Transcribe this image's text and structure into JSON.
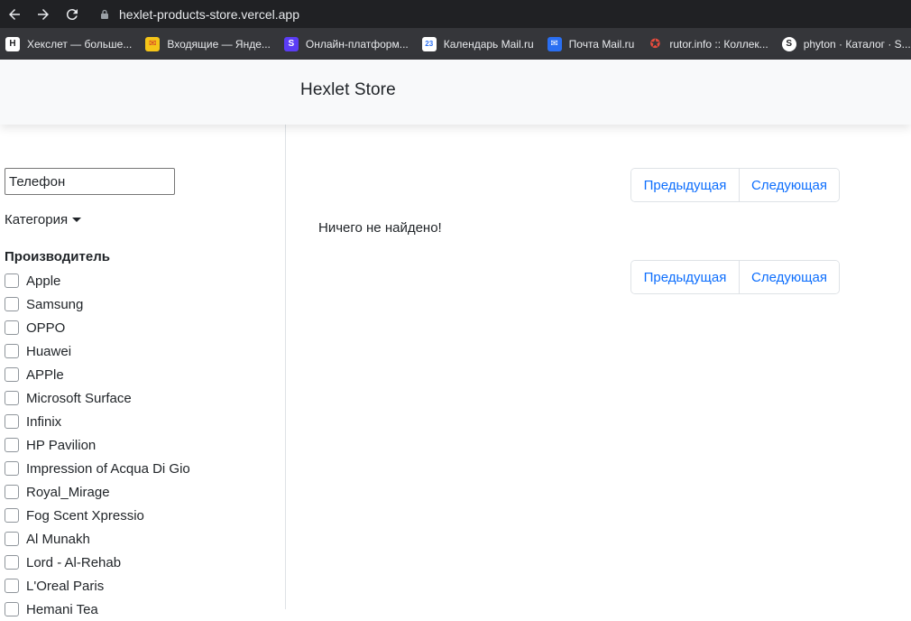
{
  "browser": {
    "url": "hexlet-products-store.vercel.app",
    "bookmarks": [
      {
        "label": "Хекслет — больше...",
        "icon": "hexlet-icon",
        "color": "#ffffff"
      },
      {
        "label": "Входящие — Янде...",
        "icon": "mail-envelope-icon",
        "color": "#f5c518"
      },
      {
        "label": "Онлайн-платформ...",
        "icon": "s-logo-icon",
        "color": "#5b3df5"
      },
      {
        "label": "Календарь Mail.ru",
        "icon": "calendar-icon",
        "color": "#2a6ff2"
      },
      {
        "label": "Почта Mail.ru",
        "icon": "mail-icon",
        "color": "#2a6ff2"
      },
      {
        "label": "rutor.info :: Коллек...",
        "icon": "rutor-icon",
        "color": "#e84c3d"
      },
      {
        "label": "phyton · Каталог · S...",
        "icon": "link-icon",
        "color": "#ffffff"
      }
    ]
  },
  "header": {
    "brand": "Hexlet Store"
  },
  "sidebar": {
    "search_value": "Телефон",
    "category_label": "Категория",
    "maker_title": "Производитель",
    "makers": [
      "Apple",
      "Samsung",
      "OPPO",
      "Huawei",
      "APPle",
      "Microsoft Surface",
      "Infinix",
      "HP Pavilion",
      "Impression of Acqua Di Gio",
      "Royal_Mirage",
      "Fog Scent Xpressio",
      "Al Munakh",
      "Lord - Al-Rehab",
      "L'Oreal Paris",
      "Hemani Tea"
    ]
  },
  "main": {
    "prev_label": "Предыдущая",
    "next_label": "Следующая",
    "empty_message": "Ничего не найдено!"
  },
  "colors": {
    "link": "#0d6efd",
    "browser_bg": "#202124",
    "bookmarks_bg": "#35363a"
  }
}
